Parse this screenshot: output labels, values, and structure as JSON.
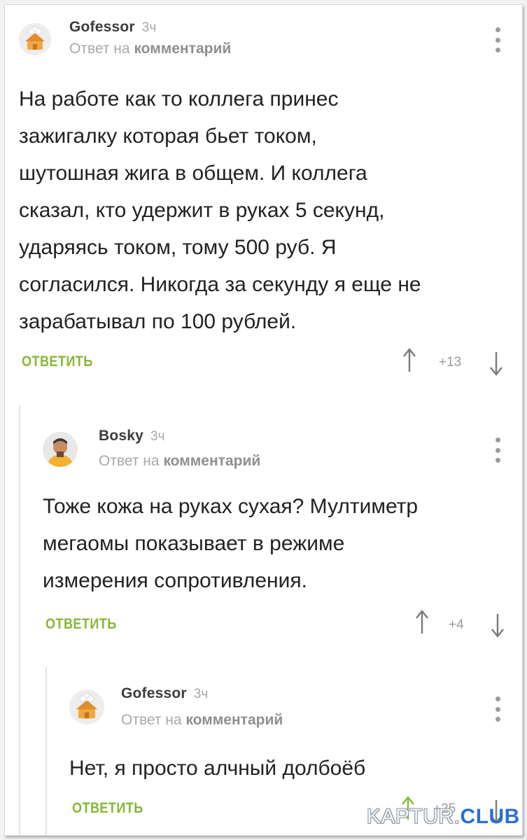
{
  "comments": [
    {
      "author": "Gofessor",
      "time": "3ч",
      "reply_prefix": "Ответ на",
      "reply_target": "комментарий",
      "text_lines": [
        "На работе как то коллега принес",
        "зажигалку которая бьет током,",
        "шутошная жига в общем. И коллега",
        "сказал, кто удержит в руках 5 секунд,",
        "ударяясь током, тому 500 руб. Я",
        "согласился. Никогда за секунду я еще не",
        "зарабатывал по 100 рублей."
      ],
      "reply_label": "ОТВЕТИТЬ",
      "score": "+13",
      "avatar_icon": "chef-house-avatar-icon"
    },
    {
      "author": "Bosky",
      "time": "3ч",
      "reply_prefix": "Ответ на",
      "reply_target": "комментарий",
      "text_lines": [
        "Тоже кожа на руках сухая? Мултиметр",
        "мегаомы показывает в режиме",
        "измерения сопротивления."
      ],
      "reply_label": "ОТВЕТИТЬ",
      "score": "+4",
      "avatar_icon": "person-avatar-icon"
    },
    {
      "author": "Gofessor",
      "time": "3ч",
      "reply_prefix": "Ответ на",
      "reply_target": "комментарий",
      "text_lines": [
        "Нет, я просто алчный долбоёб"
      ],
      "reply_label": "ОТВЕТИТЬ",
      "score": "+25",
      "avatar_icon": "chef-house-avatar-icon"
    }
  ],
  "watermark": {
    "main": "KAPTUR.",
    "accent": "CLUB"
  },
  "colors": {
    "reply_green": "#86b738",
    "author_text": "#3b3b3b",
    "muted_text": "#a9a9a9",
    "body_text": "#222222"
  }
}
